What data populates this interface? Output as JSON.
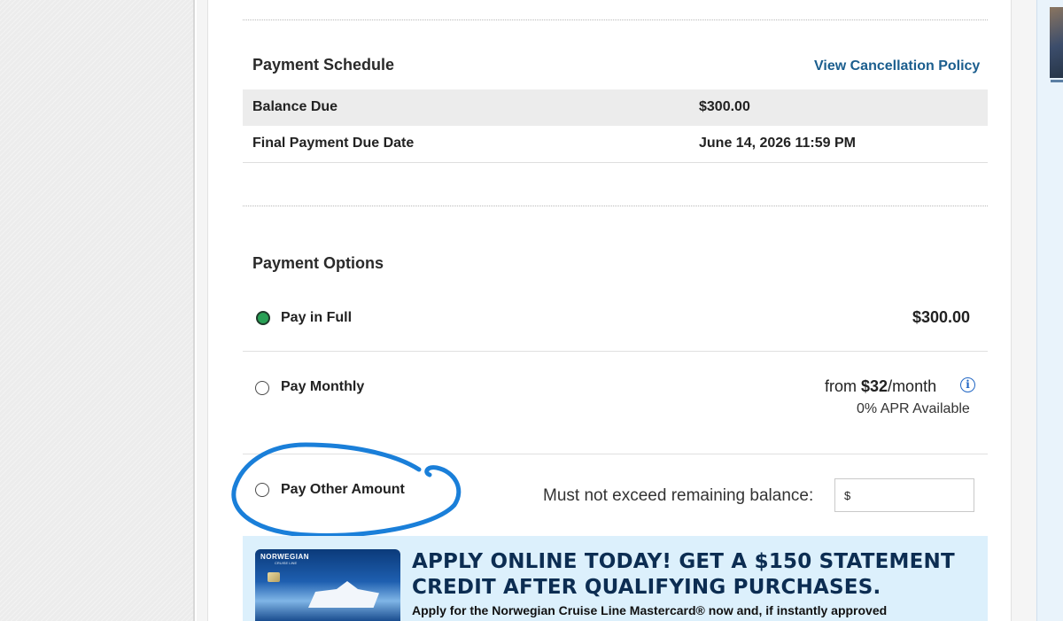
{
  "schedule": {
    "title": "Payment Schedule",
    "cancellation_link": "View Cancellation Policy",
    "rows": [
      {
        "label": "Balance Due",
        "value": "$300.00"
      },
      {
        "label": "Final Payment Due Date",
        "value": "June 14, 2026 11:59 PM"
      }
    ]
  },
  "options": {
    "title": "Payment Options",
    "pay_full": {
      "label": "Pay in Full",
      "amount": "$300.00",
      "selected": true
    },
    "pay_monthly": {
      "label": "Pay Monthly",
      "from_text": "from ",
      "monthly_amount": "$32",
      "per_text": "/month",
      "info_icon": "i",
      "apr_text": "0% APR Available",
      "selected": false
    },
    "pay_other": {
      "label": "Pay Other Amount",
      "hint": "Must not exceed remaining balance:",
      "input_value": "$",
      "selected": false
    }
  },
  "promo": {
    "card_brand": "NORWEGIAN",
    "card_sub": "CRUISE LINE",
    "headline_line1": "APPLY ONLINE TODAY! GET A $150 STATEMENT",
    "headline_line2": "CREDIT AFTER QUALIFYING PURCHASES.",
    "subtext": "Apply for the Norwegian Cruise Line Mastercard® now and, if instantly approved"
  },
  "colors": {
    "link": "#1b5e8e",
    "radio_selected": "#28a055",
    "promo_bg": "#dcf0fc",
    "promo_heading": "#0c2d52",
    "annotation": "#1a7fd9"
  },
  "annotation": {
    "type": "hand-drawn circle",
    "target": "pay-other-amount"
  }
}
